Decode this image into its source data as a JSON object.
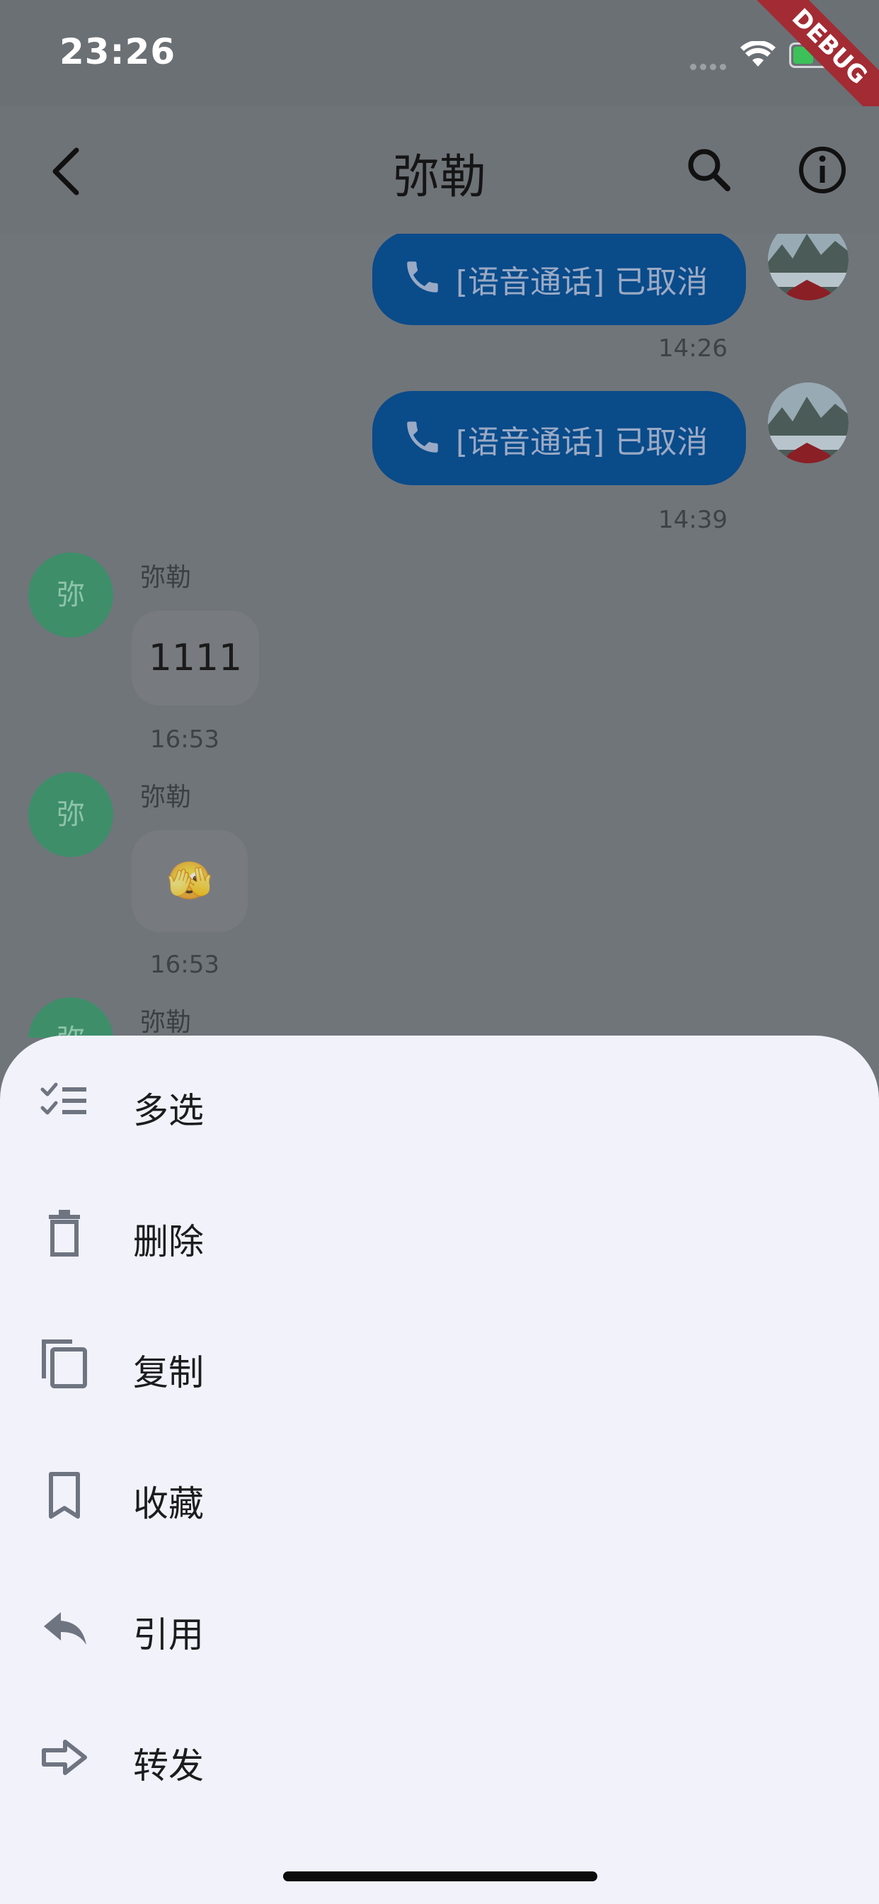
{
  "status_bar": {
    "time": "23:26",
    "debug_banner": "DEBUG"
  },
  "header": {
    "title": "弥勒"
  },
  "messages": [
    {
      "direction": "outgoing",
      "text": "[语音通话] 已取消",
      "time": "14:26"
    },
    {
      "direction": "outgoing",
      "text": "[语音通话] 已取消",
      "time": "14:39"
    },
    {
      "direction": "incoming",
      "sender": "弥勒",
      "avatar_text": "弥",
      "text": "1111",
      "time": "16:53"
    },
    {
      "direction": "incoming",
      "sender": "弥勒",
      "avatar_text": "弥",
      "emoji": "🫣",
      "time": "16:53"
    },
    {
      "direction": "incoming",
      "sender": "弥勒",
      "avatar_text": "弥"
    }
  ],
  "action_sheet": {
    "items": [
      {
        "label": "多选",
        "icon": "checklist-icon"
      },
      {
        "label": "删除",
        "icon": "trash-icon"
      },
      {
        "label": "复制",
        "icon": "copy-icon"
      },
      {
        "label": "收藏",
        "icon": "bookmark-icon"
      },
      {
        "label": "引用",
        "icon": "reply-icon"
      },
      {
        "label": "转发",
        "icon": "forward-arrow-icon"
      }
    ]
  },
  "colors": {
    "accent_bubble": "#0a4b8a",
    "avatar_green": "#3e8e6a",
    "sheet_bg": "#f1f2fa",
    "icon_gray": "#6e7480"
  }
}
